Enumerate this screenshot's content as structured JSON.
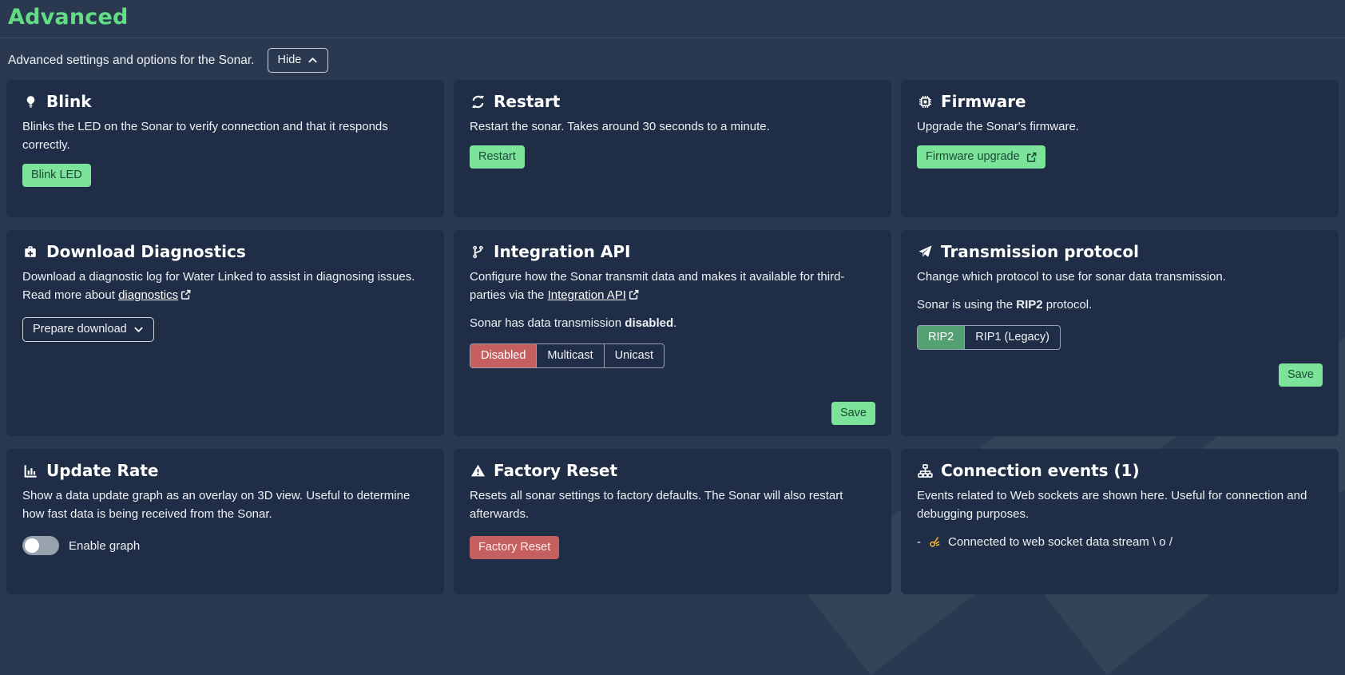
{
  "colors": {
    "page_bg": "#2a3950",
    "card_bg": "#1f2e46",
    "accent_green": "#61de84",
    "button_green": "#7be39a",
    "selected_green": "#53a173",
    "danger_red": "#c65f5f",
    "text": "#eef1f5"
  },
  "header": {
    "title": "Advanced",
    "subtitle": "Advanced settings and options for the Sonar.",
    "hide_label": "Hide",
    "hide_icon": "chevron-up-icon"
  },
  "cards": {
    "blink": {
      "icon": "lightbulb-icon",
      "title": "Blink",
      "description": "Blinks the LED on the Sonar to verify connection and that it responds correctly.",
      "button_label": "Blink LED"
    },
    "restart": {
      "icon": "sync-icon",
      "title": "Restart",
      "description": "Restart the sonar. Takes around 30 seconds to a minute.",
      "button_label": "Restart"
    },
    "firmware": {
      "icon": "microchip-icon",
      "title": "Firmware",
      "description": "Upgrade the Sonar's firmware.",
      "button_label": "Firmware upgrade",
      "button_icon": "external-link-icon"
    },
    "download_diagnostics": {
      "icon": "briefcase-medical-icon",
      "title": "Download Diagnostics",
      "desc_before_link": "Download a diagnostic log for Water Linked to assist in diagnosing issues. Read more about ",
      "link_label": "diagnostics",
      "link_icon": "external-link-icon",
      "button_label": "Prepare download",
      "button_icon": "chevron-down-icon"
    },
    "integration_api": {
      "icon": "code-branch-icon",
      "title": "Integration API",
      "desc_before_link": "Configure how the Sonar transmit data and makes it available for third-parties via the ",
      "link_label": "Integration API",
      "link_icon": "external-link-icon",
      "status_prefix": "Sonar has data transmission ",
      "status_bold": "disabled",
      "status_suffix": ".",
      "options": [
        "Disabled",
        "Multicast",
        "Unicast"
      ],
      "selected_option": "Disabled",
      "save_label": "Save"
    },
    "transmission_protocol": {
      "icon": "paper-plane-icon",
      "title": "Transmission protocol",
      "description": "Change which protocol to use for sonar data transmission.",
      "status_prefix": "Sonar is using the ",
      "status_bold": "RIP2",
      "status_suffix": " protocol.",
      "options": [
        "RIP2",
        "RIP1 (Legacy)"
      ],
      "selected_option": "RIP2",
      "save_label": "Save"
    },
    "update_rate": {
      "icon": "chart-column-icon",
      "title": "Update Rate",
      "description": "Show a data update graph as an overlay on 3D view. Useful to determine how fast data is being received from the Sonar.",
      "toggle_label": "Enable graph",
      "toggle_on": false
    },
    "factory_reset": {
      "icon": "warning-triangle-icon",
      "title": "Factory Reset",
      "description": "Resets all sonar settings to factory defaults. The Sonar will also restart afterwards.",
      "button_label": "Factory Reset"
    },
    "connection_events": {
      "icon": "sitemap-icon",
      "title": "Connection events (1)",
      "description": "Events related to Web sockets are shown here. Useful for connection and debugging purposes.",
      "event_bullet": "-",
      "event_emoji": "👌",
      "event_text": "Connected to web socket data stream \\ o /"
    }
  }
}
